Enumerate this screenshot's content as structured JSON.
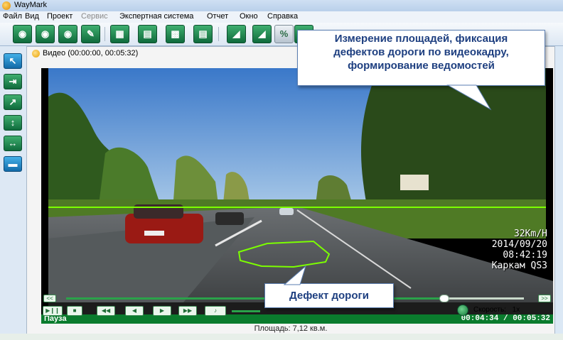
{
  "window": {
    "title": "WayMark",
    "app_icon": "waymark-icon"
  },
  "menu": [
    "Файл",
    "Вид",
    "Проект",
    "Сервис",
    "Экспертная система",
    "Отчет",
    "Окно",
    "Справка"
  ],
  "toolbar": {
    "buttons": [
      "camera-road-icon",
      "camera-add-icon",
      "camera-download-icon",
      "camera-edit-icon",
      "grid-icon",
      "road-measure-icon",
      "film-icon",
      "report-chart-icon",
      "arrow-left-icon",
      "measure-icon",
      "percent-icon",
      "export-icon"
    ],
    "percent_label": "%"
  },
  "left_tools": [
    "pointer-icon",
    "arrow-right-icon",
    "arrow-right-up-icon",
    "vertical-arrows-icon",
    "horizontal-arrows-icon",
    "rectangle-icon"
  ],
  "video_window": {
    "title": "Видео (00:00:00, 00:05:32)"
  },
  "osd": {
    "speed": "32Km/H",
    "date": "2014/09/20",
    "time": "08:42:19",
    "device": "Каркам QS3"
  },
  "status": {
    "state": "Пауза",
    "timecode": "00:04:34 / 00:05:32"
  },
  "playback": {
    "prev_label": "<<",
    "next_label": ">>",
    "controls": [
      "play-pause-icon",
      "stop-icon",
      "skip-back-icon",
      "step-back-icon",
      "step-forward-icon",
      "skip-forward-icon",
      "volume-icon"
    ],
    "position_fraction": 0.826,
    "speed_label": "Скорость:",
    "speed_value": "1x"
  },
  "area": "Площадь: 7,12 кв.м.",
  "callouts": {
    "main": [
      "Измерение площадей, фиксация",
      "дефектов дороги по видеокадру,",
      "формирование ведомостей"
    ],
    "defect": "Дефект дороги"
  },
  "colors": {
    "accent_green": "#0a7b2d",
    "callout_text": "#1e3f80",
    "measure_line": "#7cff00"
  }
}
